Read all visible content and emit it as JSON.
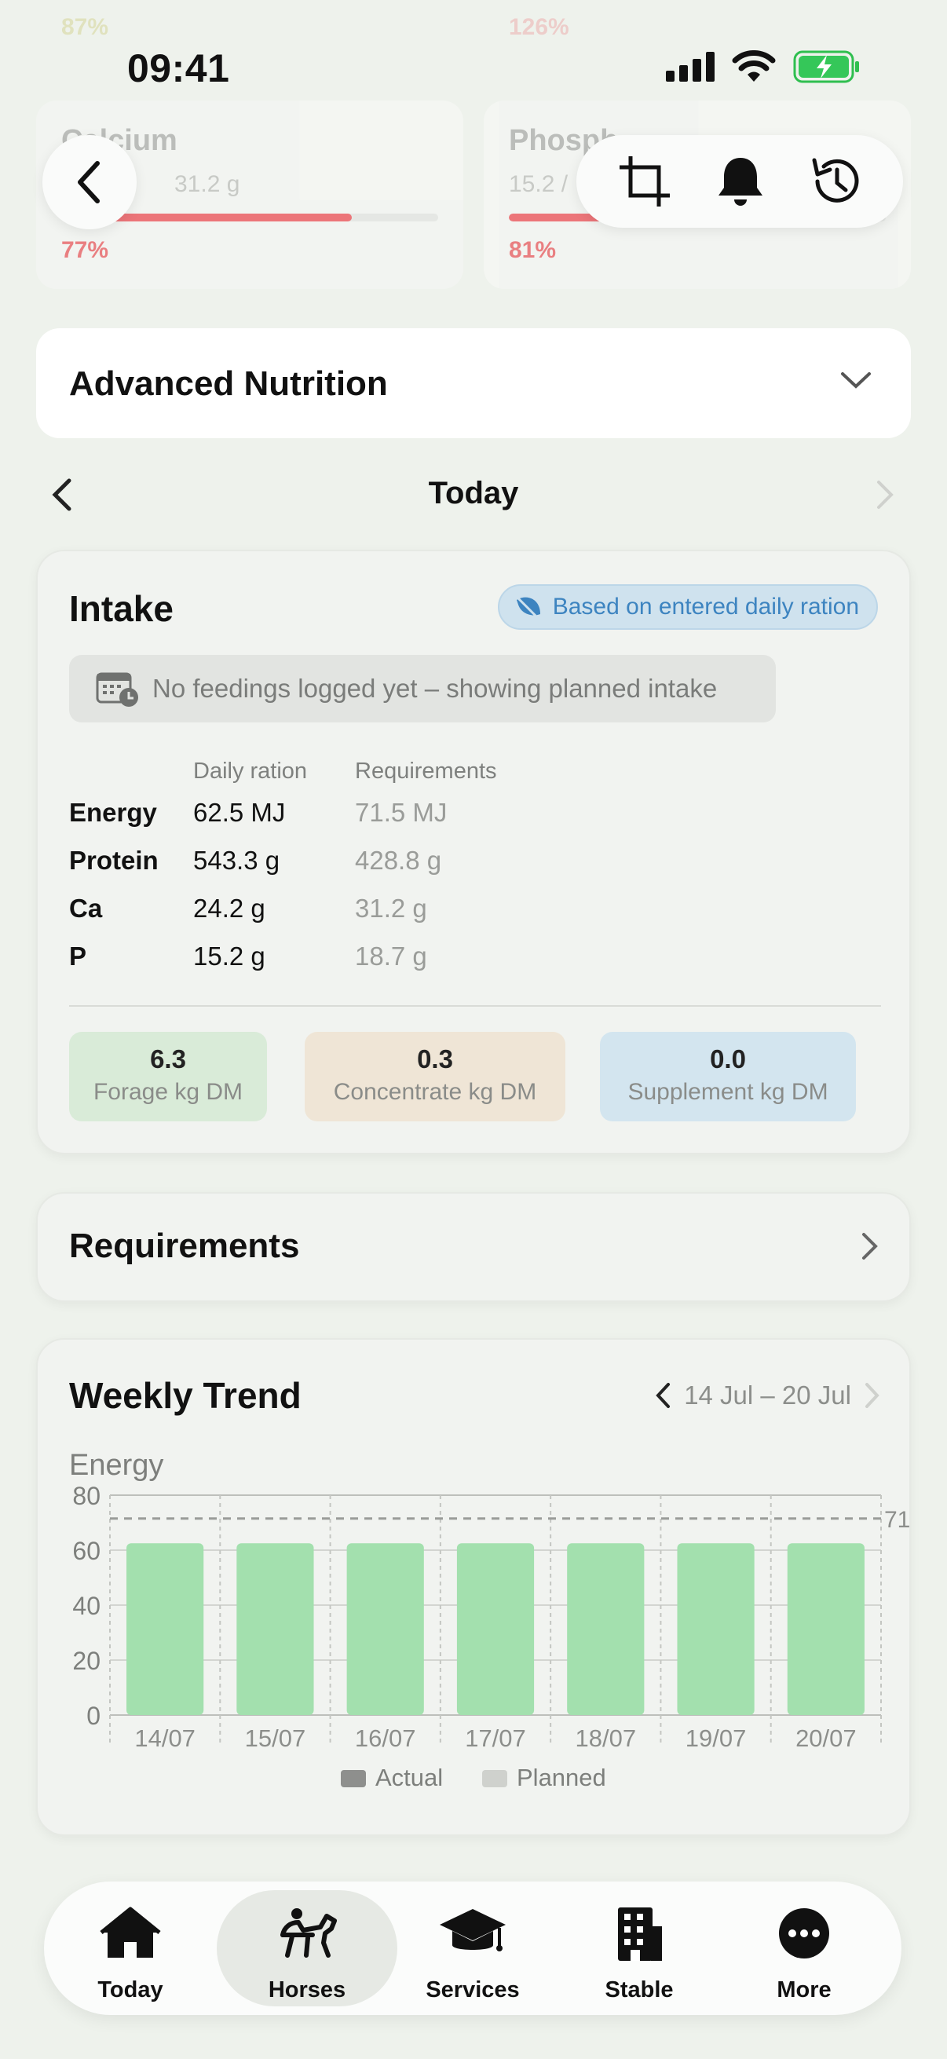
{
  "top_ghost": {
    "left_pct": "87%",
    "right_pct": "126%"
  },
  "status_bar": {
    "time": "09:41"
  },
  "nutrient_cards": [
    {
      "name": "Calcium",
      "value": "31.2 g",
      "percent": "77%",
      "fill_pct": 77
    },
    {
      "name": "Phosph",
      "value": "15.2 /",
      "percent": "81%",
      "fill_pct": 81
    }
  ],
  "header_actions": {
    "icons": [
      "back-chevron-icon",
      "crop-icon",
      "bell-icon",
      "history-icon"
    ]
  },
  "advanced_nutrition": {
    "label": "Advanced Nutrition"
  },
  "day_nav": {
    "label": "Today"
  },
  "intake": {
    "title": "Intake",
    "badge": "Based on entered daily ration",
    "notice": "No feedings logged yet – showing planned intake",
    "col_daily": "Daily ration",
    "col_req": "Requirements",
    "rows": [
      {
        "label": "Energy",
        "daily": "62.5 MJ",
        "req": "71.5 MJ"
      },
      {
        "label": "Protein",
        "daily": "543.3 g",
        "req": "428.8 g"
      },
      {
        "label": "Ca",
        "daily": "24.2 g",
        "req": "31.2 g"
      },
      {
        "label": "P",
        "daily": "15.2 g",
        "req": "18.7 g"
      }
    ],
    "tiles": [
      {
        "value": "6.3",
        "label": "Forage kg DM",
        "color": "#d9ebd8"
      },
      {
        "value": "0.3",
        "label": "Concentrate kg DM",
        "color": "#efe5d6"
      },
      {
        "value": "0.0",
        "label": "Supplement kg DM",
        "color": "#d3e5ef"
      }
    ]
  },
  "requirements": {
    "label": "Requirements"
  },
  "weekly_trend": {
    "title": "Weekly Trend",
    "range": "14 Jul – 20 Jul"
  },
  "chart_data": {
    "type": "bar",
    "title": "Energy",
    "categories": [
      "14/07",
      "15/07",
      "16/07",
      "17/07",
      "18/07",
      "19/07",
      "20/07"
    ],
    "series": [
      {
        "name": "Actual",
        "values": [
          0,
          0,
          0,
          0,
          0,
          0,
          0
        ],
        "color": "#8e8f8d"
      },
      {
        "name": "Planned",
        "values": [
          62.5,
          62.5,
          62.5,
          62.5,
          62.5,
          62.5,
          62.5
        ],
        "color": "#a3e0ae"
      }
    ],
    "reference_line": {
      "value": 71.5,
      "label": "71"
    },
    "ylim": [
      0,
      80
    ],
    "yticks": [
      "0",
      "20",
      "40",
      "60",
      "80"
    ],
    "grid": true,
    "legend": "bottom"
  },
  "tab_bar": {
    "tabs": [
      {
        "label": "Today",
        "icon": "house-icon"
      },
      {
        "label": "Horses",
        "icon": "horse-rider-icon",
        "active": true
      },
      {
        "label": "Services",
        "icon": "graduation-cap-icon"
      },
      {
        "label": "Stable",
        "icon": "building-icon"
      },
      {
        "label": "More",
        "icon": "more-dots-icon"
      }
    ]
  }
}
